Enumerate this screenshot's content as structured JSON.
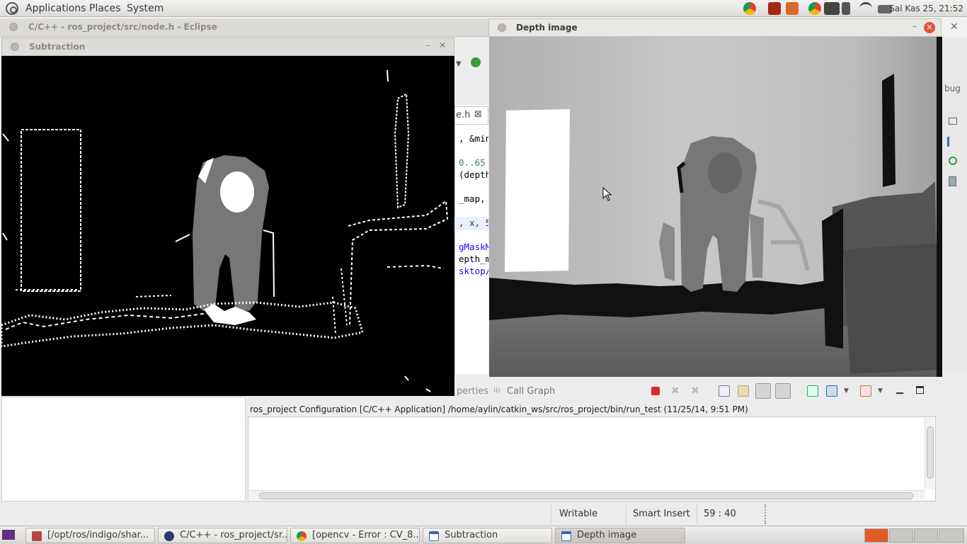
{
  "top_panel": {
    "menus": [
      "Applications",
      "Places",
      "System"
    ],
    "clock": "Sal Kas 25, 21:52"
  },
  "eclipse": {
    "title": "C/C++ - ros_project/src/node.h - Eclipse",
    "editor_tab": "e.h",
    "code_lines": [
      ", &min",
      " 0..65",
      "(depth",
      "_map, ",
      ", x, 5",
      "gMaskM",
      "epth_m",
      "sktop/"
    ],
    "debug_label": "bug",
    "properties_label": "perties",
    "call_graph_label": "Call Graph",
    "console_description": "ros_project Configuration [C/C++ Application] /home/aylin/catkin_ws/src/ros_project/bin/run_test (11/25/14, 9:51 PM)",
    "status": {
      "writable": "Writable",
      "insert_mode": "Smart Insert",
      "position": "59 : 40"
    }
  },
  "subtraction_window": {
    "title": "Subtraction"
  },
  "depth_window": {
    "title": "Depth image"
  },
  "taskbar": {
    "tasks": [
      "[/opt/ros/indigo/shar...",
      "C/C++ - ros_project/sr...",
      "[opencv - Error : CV_8...",
      "Subtraction",
      "Depth image"
    ]
  },
  "colors": {
    "accent_close": "#e0533b",
    "link_blue": "#2a00ff",
    "code_green": "#3f7f5f"
  }
}
